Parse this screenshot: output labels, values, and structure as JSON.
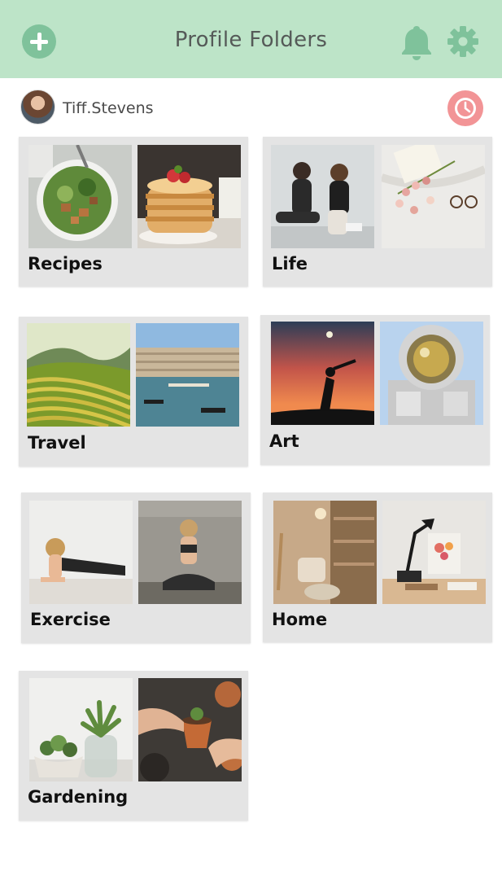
{
  "header": {
    "title": "Profile Folders"
  },
  "user": {
    "name": "Tiff.Stevens"
  },
  "folders": [
    {
      "label": "Recipes"
    },
    {
      "label": "Life"
    },
    {
      "label": "Travel"
    },
    {
      "label": "Art"
    },
    {
      "label": "Exercise"
    },
    {
      "label": "Home"
    },
    {
      "label": "Gardening"
    }
  ],
  "icons": {
    "add": "plus-circle-icon",
    "notifications": "bell-icon",
    "settings": "gear-icon",
    "history": "clock-icon"
  },
  "colors": {
    "header_bg": "#bde4c8",
    "accent_green": "#7fc29b",
    "clock_red": "#f29496",
    "card_bg": "#e4e4e4"
  }
}
